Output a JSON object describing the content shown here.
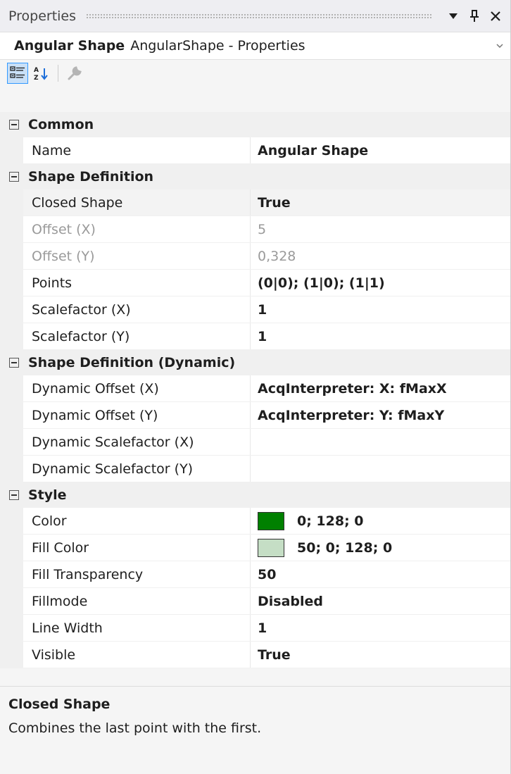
{
  "title_bar": {
    "title": "Properties",
    "buttons": [
      {
        "name": "dropdown-icon",
        "glyph": "▼"
      },
      {
        "name": "pin-icon",
        "glyph": "📌"
      },
      {
        "name": "close-icon",
        "glyph": "✕"
      }
    ]
  },
  "object_selector": {
    "name": "Angular Shape",
    "type": "AngularShape - Properties"
  },
  "toolbar": {
    "categorized_icon": "categorized-icon",
    "alphabetical_icon": "alphabetical-sort-icon",
    "property_pages_icon": "wrench-icon"
  },
  "categories": {
    "common": {
      "title": "Common",
      "rows": [
        {
          "name": "Name",
          "value": "Angular Shape"
        }
      ]
    },
    "shape_definition": {
      "title": "Shape Definition",
      "rows": [
        {
          "name": "Closed Shape",
          "value": "True"
        },
        {
          "name": "Offset (X)",
          "value": "5"
        },
        {
          "name": "Offset (Y)",
          "value": "0,328"
        },
        {
          "name": "Points",
          "value": "(0|0); (1|0); (1|1)"
        },
        {
          "name": "Scalefactor (X)",
          "value": "1"
        },
        {
          "name": "Scalefactor (Y)",
          "value": "1"
        }
      ]
    },
    "shape_definition_dynamic": {
      "title": "Shape Definition (Dynamic)",
      "rows": [
        {
          "name": "Dynamic Offset (X)",
          "value": "AcqInterpreter: X: fMaxX"
        },
        {
          "name": "Dynamic Offset (Y)",
          "value": "AcqInterpreter: Y: fMaxY"
        },
        {
          "name": "Dynamic Scalefactor (X)",
          "value": ""
        },
        {
          "name": "Dynamic Scalefactor (Y)",
          "value": ""
        }
      ]
    },
    "style": {
      "title": "Style",
      "rows": [
        {
          "name": "Color",
          "value": "0; 128; 0",
          "swatch": "#008000"
        },
        {
          "name": "Fill Color",
          "value": "50; 0; 128; 0",
          "swatch": "#c5dec5"
        },
        {
          "name": "Fill Transparency",
          "value": "50"
        },
        {
          "name": "Fillmode",
          "value": "Disabled"
        },
        {
          "name": "Line Width",
          "value": "1"
        },
        {
          "name": "Visible",
          "value": "True"
        }
      ]
    }
  },
  "description": {
    "title": "Closed Shape",
    "text": "Combines the last point with the first."
  },
  "colors": {
    "accent": "#3399ff",
    "category_bg": "#f0f0f0",
    "readonly_text": "#9a9a9a"
  }
}
